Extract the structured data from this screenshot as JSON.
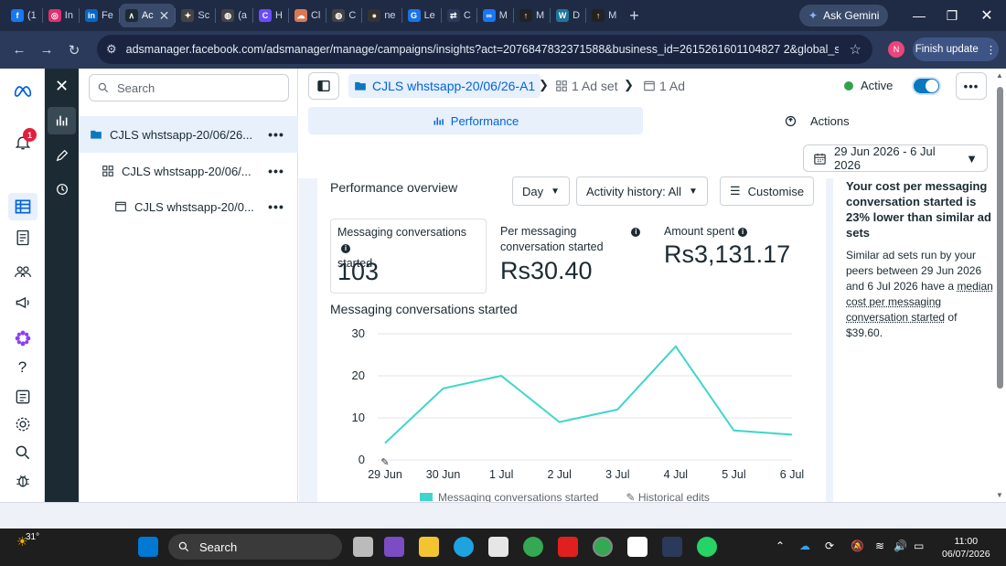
{
  "browser": {
    "tabs": [
      {
        "label": "(1",
        "color": "#1877f2",
        "glyph": "f"
      },
      {
        "label": "In",
        "color": "#e1306c",
        "glyph": "◎"
      },
      {
        "label": "Fe",
        "color": "#0a66c2",
        "glyph": "in"
      },
      {
        "label": "Ac",
        "color": "#1c2b33",
        "glyph": "∧",
        "active": true
      },
      {
        "label": "Sc",
        "color": "#444",
        "glyph": "✦"
      },
      {
        "label": "(a",
        "color": "#444",
        "glyph": "◍"
      },
      {
        "label": "H",
        "color": "#6a4cff",
        "glyph": "C"
      },
      {
        "label": "Cl",
        "color": "#d97757",
        "glyph": "☁"
      },
      {
        "label": "C",
        "color": "#444",
        "glyph": "◍"
      },
      {
        "label": "ne",
        "color": "#333",
        "glyph": "●"
      },
      {
        "label": "Le",
        "color": "#1a73e8",
        "glyph": "G"
      },
      {
        "label": "C",
        "color": "#2b3a5a",
        "glyph": "⇄"
      },
      {
        "label": "M",
        "color": "#1877f2",
        "glyph": "∞"
      },
      {
        "label": "M",
        "color": "#222",
        "glyph": "↑"
      },
      {
        "label": "D",
        "color": "#21759b",
        "glyph": "W"
      },
      {
        "label": "M",
        "color": "#222",
        "glyph": "↑"
      }
    ],
    "gemini_label": "Ask Gemini",
    "url": "adsmanager.facebook.com/adsmanager/manage/campaigns/insights?act=2076847832371588&business_id=2615261601104827 2&global_scope_...",
    "profile_initial": "N",
    "finish_update_label": "Finish update"
  },
  "rail": {
    "notification_count": "1"
  },
  "tree": {
    "search_placeholder": "Search",
    "campaign_label": "CJLS whstsapp-20/06/26...",
    "adset_label": "CJLS whstsapp-20/06/...",
    "ad_label": "CJLS whstsapp-20/0...",
    "more_glyph": "•••"
  },
  "header": {
    "campaign_crumb": "CJLS whstsapp-20/06/26-A1",
    "adset_crumb": "1 Ad set",
    "ad_crumb": "1 Ad",
    "status_label": "Active",
    "more_glyph": "•••",
    "tabs": {
      "performance": "Performance",
      "actions": "Actions"
    },
    "date_range": "29 Jun 2026 - 6 Jul 2026"
  },
  "overview": {
    "title": "Performance overview",
    "day_label": "Day",
    "activity_label": "Activity history: All",
    "customise_label": "Customise",
    "metrics": [
      {
        "label_line1": "Messaging conversations",
        "label_line2": "started",
        "value": "103"
      },
      {
        "label_line1": "Per messaging",
        "label_line2": "conversation started",
        "value": "Rs30.40"
      },
      {
        "label_line1": "Amount spent",
        "label_line2": "",
        "value": "Rs3,131.17"
      }
    ],
    "chart_title": "Messaging conversations started",
    "legend_series": "Messaging conversations started",
    "legend_edits": "Historical edits"
  },
  "chart_data": {
    "type": "line",
    "title": "Messaging conversations started",
    "x": [
      "29 Jun",
      "30 Jun",
      "1 Jul",
      "2 Jul",
      "3 Jul",
      "4 Jul",
      "5 Jul",
      "6 Jul"
    ],
    "series": [
      {
        "name": "Messaging conversations started",
        "values": [
          4,
          17,
          20,
          9,
          12,
          27,
          7,
          6
        ],
        "color": "#3ed6cc"
      }
    ],
    "ylim": [
      0,
      30
    ],
    "yticks": [
      0,
      10,
      20,
      30
    ],
    "grid": true,
    "legend": "bottom"
  },
  "insight": {
    "title": "Your cost per messaging conversation started is 23% lower than similar ad sets",
    "body_prefix": "Similar ad sets run by your peers between 29 Jun 2026 and 6 Jul 2026 have a ",
    "body_link": "median cost per messaging conversation started",
    "body_suffix": " of $39.60."
  },
  "taskbar": {
    "temperature": "31°",
    "search_label": "Search",
    "time": "11:00",
    "date": "06/07/2026"
  },
  "colors": {
    "accent": "#0064e0",
    "series": "#3ed6cc",
    "active_dot": "#31a24c"
  }
}
